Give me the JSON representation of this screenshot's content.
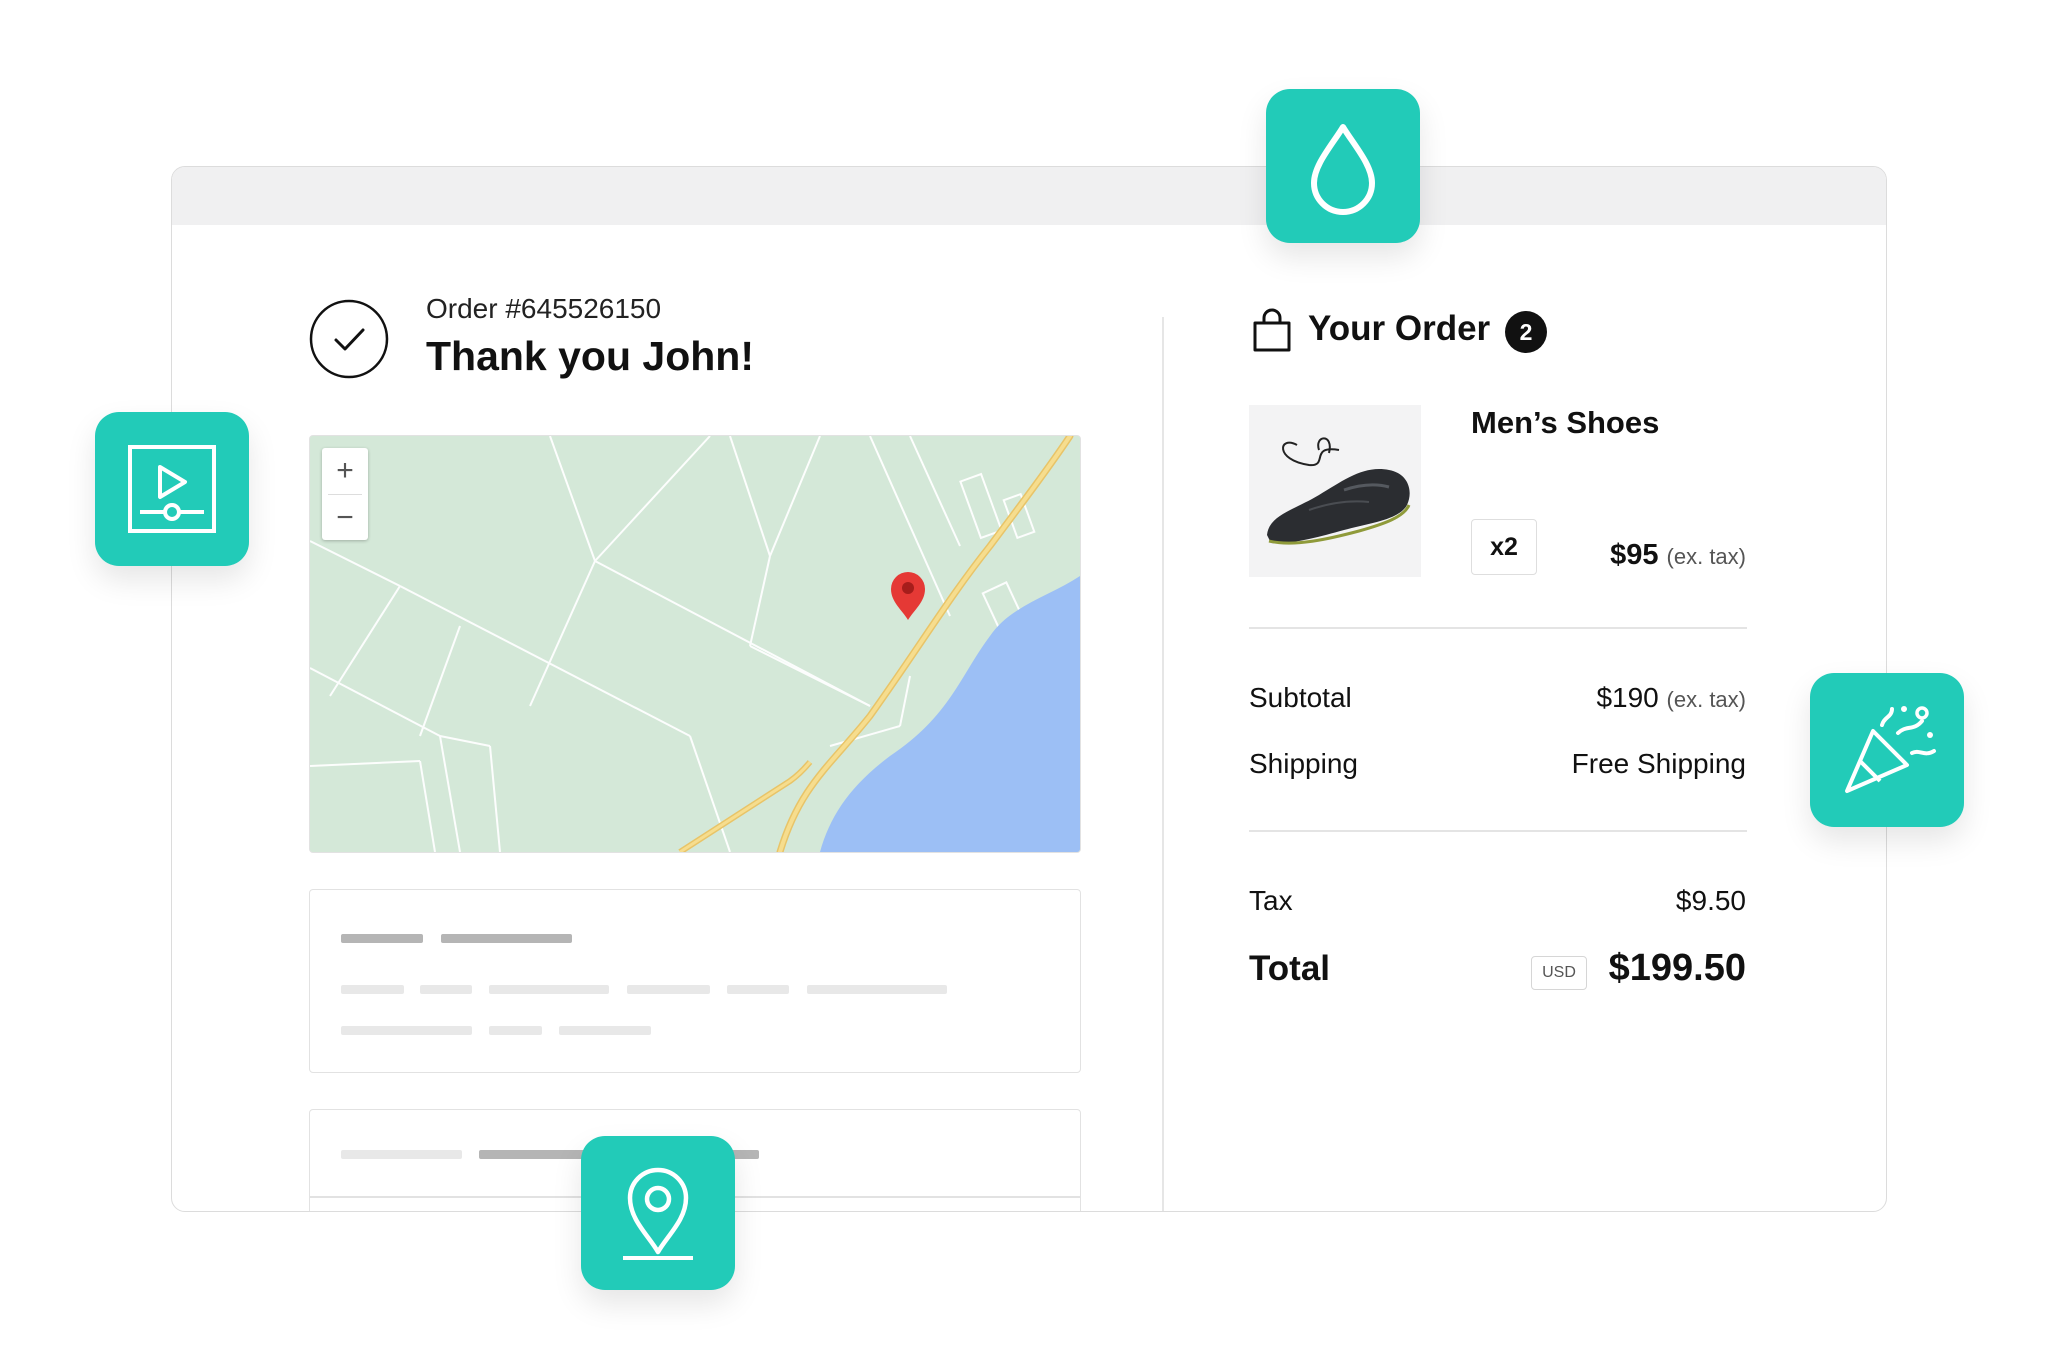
{
  "order": {
    "number": "Order #645526150",
    "greeting": "Thank you John!"
  },
  "map": {
    "zoom_in": "+",
    "zoom_out": "−"
  },
  "summary": {
    "title": "Your Order",
    "item_count": "2",
    "item": {
      "name": "Men’s Shoes",
      "quantity": "x2",
      "price": "$95",
      "price_note": "(ex. tax)"
    },
    "subtotal_label": "Subtotal",
    "subtotal_value": "$190",
    "subtotal_note": "(ex. tax)",
    "shipping_label": "Shipping",
    "shipping_value": "Free Shipping",
    "tax_label": "Tax",
    "tax_value": "$9.50",
    "total_label": "Total",
    "currency": "USD",
    "total_value": "$199.50"
  },
  "colors": {
    "accent": "#22cbb8",
    "map_land": "#d4e8d8",
    "map_water": "#9cbff5",
    "map_road": "#f3d27a",
    "pin": "#e53935"
  },
  "icons": [
    "checkmark-circle-icon",
    "shopping-bag-icon",
    "drop-icon",
    "video-player-icon",
    "party-popper-icon",
    "location-pin-icon",
    "map-marker-icon"
  ]
}
